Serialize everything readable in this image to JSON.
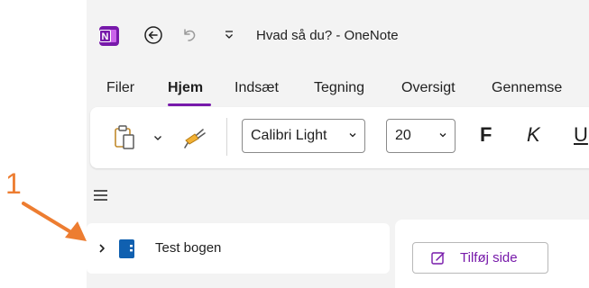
{
  "window": {
    "title": "Hvad så du? - OneNote",
    "app_icon": "onenote-logo"
  },
  "ribbon_tabs": [
    "Filer",
    "Hjem",
    "Indsæt",
    "Tegning",
    "Oversigt",
    "Gennemse"
  ],
  "active_tab": "Hjem",
  "ribbon": {
    "font_name": "Calibri Light",
    "font_size": "20",
    "bold_label": "F",
    "italic_label": "K",
    "underline_label": "U"
  },
  "notebook": {
    "name": "Test bogen"
  },
  "page_pane": {
    "add_page_label": "Tilføj side"
  },
  "annotation": {
    "number": "1",
    "color": "#ed7d31"
  },
  "colors": {
    "accent": "#7719aa",
    "annotation": "#ed7d31"
  }
}
